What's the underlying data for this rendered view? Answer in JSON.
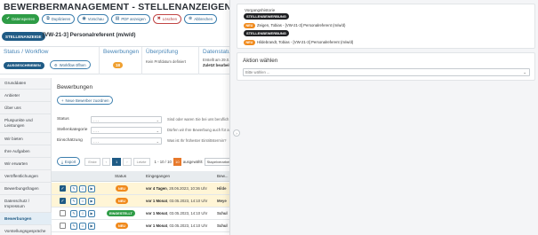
{
  "page": {
    "title": "BEWERBERMANAGEMENT - STELLENANZEIGEN",
    "toolbar": [
      {
        "label": "Datensperren",
        "icon": "✔",
        "icon_name": "check-icon",
        "style": "primary"
      },
      {
        "label": "Duplizieren",
        "icon": "⧉",
        "icon_name": "duplicate-icon",
        "style": "outline"
      },
      {
        "label": "Vorschau",
        "icon": "◉",
        "icon_name": "eye-icon",
        "style": "outline"
      },
      {
        "label": "PDF anzeigen",
        "icon": "▤",
        "icon_name": "pdf-icon",
        "style": "outline"
      },
      {
        "label": "Löschen",
        "icon": "✖",
        "icon_name": "delete-icon",
        "style": "danger"
      },
      {
        "label": "Abbrechen",
        "icon": "⊗",
        "icon_name": "cancel-icon",
        "style": "outline"
      }
    ],
    "record_badge": "STELLENANZEIGE",
    "record_title": "[VW-21-3] Personalreferent (m/w/d)"
  },
  "info": {
    "status_head": "Status / Workflow",
    "status_value": "AUSGESCHRIEBEN",
    "workflow_btn": "Workflow öffnen",
    "bewerbungen_head": "Bewerbungen",
    "bewerbungen_count": "18",
    "ueberpruefung_head": "Überprüfung",
    "ueberpruefung_text": "Kein Prüfdatum definiert",
    "datenstatus_head": "Datenstatus",
    "datenstatus_line1": "Erstellt am 29.0...",
    "datenstatus_line2": "Zuletzt bearbeitet..."
  },
  "sidebar": {
    "items": [
      {
        "label": "Grunddaten"
      },
      {
        "label": "Anbieter"
      },
      {
        "label": "Über uns"
      },
      {
        "label": "Pluspunkte und Leistungen"
      },
      {
        "label": "Wir bieten"
      },
      {
        "label": "Ihre Aufgaben"
      },
      {
        "label": "Wir erwarten"
      },
      {
        "label": "Veröffentlichungen"
      },
      {
        "label": "Bewerbungsfragen"
      },
      {
        "label": "Datenschutz / Impressum"
      },
      {
        "label": "Bewerbungen"
      },
      {
        "label": "Vorstellungsgespräche"
      }
    ]
  },
  "main": {
    "section_title": "Bewerbungen",
    "new_btn": "Neue Bewerber zuordnen",
    "filters": [
      {
        "label": "Status",
        "value": "- - -",
        "hint": "Sind oder waren Sie bei uns beruflich tätig?"
      },
      {
        "label": "Stellenkategorie",
        "value": "- - -",
        "hint": "Dürfen wir Ihre Bewerbung auch für andere Stellen berücksichtigen?"
      },
      {
        "label": "Einschätzung",
        "value": "- - -",
        "hint": "Was ist Ihr frühester Eintrittstermin?"
      }
    ],
    "pager": {
      "export": "Export",
      "first": "Erste",
      "prev": "‹",
      "current": "1",
      "next": "›",
      "last": "Letzte",
      "range": "1 - 10 / 10",
      "page_size": "10",
      "shown": "ausgewählt",
      "sort": "Stapelverarbeitung"
    },
    "columns": [
      "Status",
      "Eingegangen",
      "Bew..."
    ],
    "rows": [
      {
        "status": "NEU",
        "status_type": "new",
        "date_rel": "vor 4 Tagen",
        "date_abs": "28.06.2023, 10:36 Uhr",
        "name": "Hilde",
        "selected": true
      },
      {
        "status": "NEU",
        "status_type": "new",
        "date_rel": "vor 1 Monat",
        "date_abs": "03.05.2023, 14:10 Uhr",
        "name": "Meye",
        "selected": true
      },
      {
        "status": "EINGESTELLT",
        "status_type": "vor",
        "date_rel": "vor 1 Monat",
        "date_abs": "03.05.2023, 14:10 Uhr",
        "name": "Schul",
        "selected": false
      },
      {
        "status": "NEU",
        "status_type": "new",
        "date_rel": "vor 1 Monat",
        "date_abs": "03.05.2023, 14:10 Uhr",
        "name": "Schul",
        "selected": false
      }
    ]
  },
  "drawer": {
    "history_head": "Vorgangshistorie",
    "history": [
      {
        "kind": "dark",
        "label": "STELLENBEWERBUNG"
      },
      {
        "kind": "entry",
        "badge": "NEU",
        "text": "Zeigen, Tobias - [VW-21-3] Personalreferent (m/w/d)"
      },
      {
        "kind": "dark",
        "label": "STELLENBEWERBUNG"
      },
      {
        "kind": "entry",
        "badge": "NEU",
        "text": "Hildebrandt, Tobias - [VW-21-3] Personalreferent (m/w/d)"
      }
    ],
    "action_head": "Aktion wählen",
    "action_placeholder": "Bitte wählen ..."
  }
}
